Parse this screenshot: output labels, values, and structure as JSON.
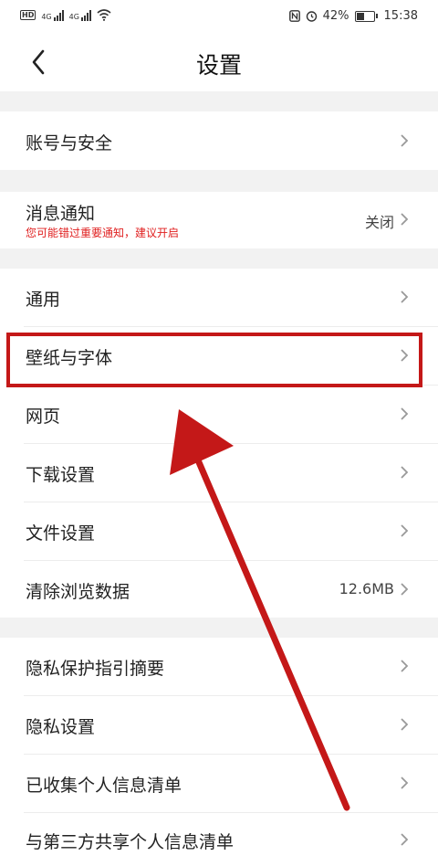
{
  "status_bar": {
    "network_badge": "HD",
    "sim1": "4G",
    "sim2": "4G",
    "battery_percent": "42%",
    "battery_level": 0.42,
    "time": "15:38"
  },
  "header": {
    "title": "设置",
    "back_icon": "chevron-left-icon"
  },
  "sections": {
    "account": {
      "label": "账号与安全"
    },
    "notify": {
      "label": "消息通知",
      "sub": "您可能错过重要通知，建议开启",
      "value": "关闭"
    },
    "general": {
      "label": "通用"
    },
    "wallpaper": {
      "label": "壁纸与字体"
    },
    "web": {
      "label": "网页"
    },
    "download": {
      "label": "下载设置"
    },
    "file": {
      "label": "文件设置"
    },
    "clear": {
      "label": "清除浏览数据",
      "value": "12.6MB"
    },
    "privacy_summary": {
      "label": "隐私保护指引摘要"
    },
    "privacy_settings": {
      "label": "隐私设置"
    },
    "collected": {
      "label": "已收集个人信息清单"
    },
    "third_party": {
      "label": "与第三方共享个人信息清单"
    }
  },
  "colors": {
    "highlight": "#c41818",
    "warning_text": "#e02020",
    "section_gap": "#f2f2f2"
  }
}
